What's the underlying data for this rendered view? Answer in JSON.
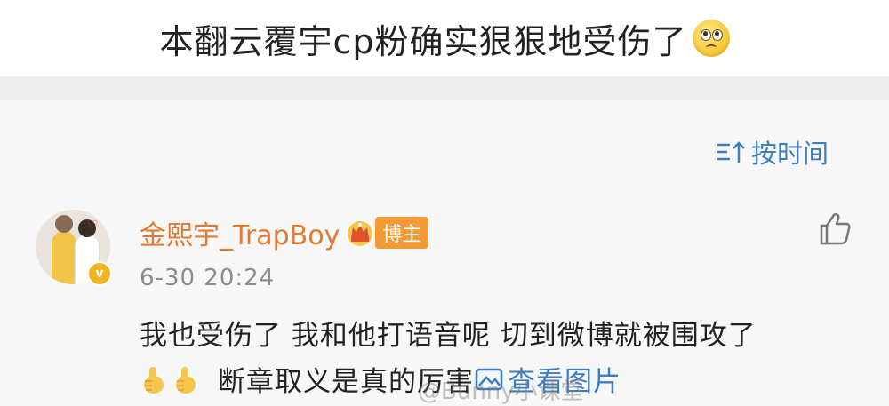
{
  "post": {
    "title": "本翻云覆宇cp粉确实狠狠地受伤了"
  },
  "sort": {
    "label": "按时间"
  },
  "comment": {
    "author": "金熙宇_TrapBoy",
    "badge": "博主",
    "timestamp": "6-30 20:24",
    "line1": "我也受伤了 我和他打语音呢 切到微博就被围攻了",
    "line2_text": "断章取义是真的厉害",
    "view_pic_label": "查看图片"
  },
  "watermark": {
    "text": "@Bunny小课堂"
  },
  "colors": {
    "accent_blue": "#3d7fbf",
    "author_orange": "#e37a2f",
    "badge_orange": "#f29a35"
  }
}
